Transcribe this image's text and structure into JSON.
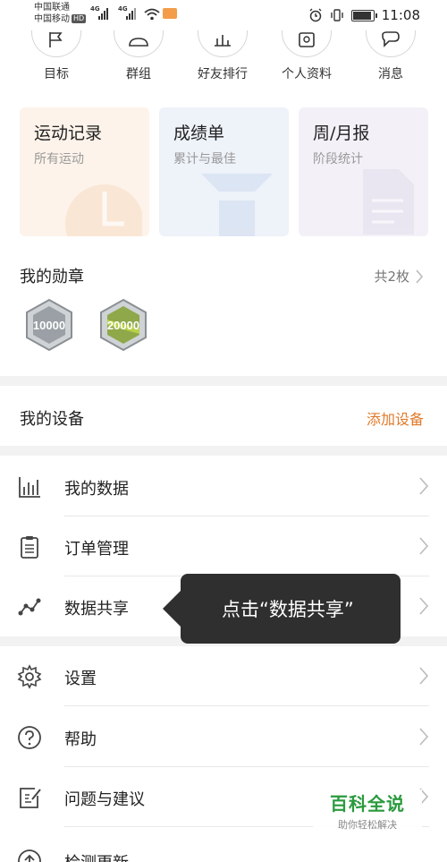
{
  "status_bar": {
    "carrier1": "中国联通",
    "carrier2": "中国移动",
    "hd": "HD",
    "net1": "4G",
    "net2": "4G",
    "time": "11:08"
  },
  "top_nav": [
    {
      "label": "目标",
      "icon": "flag-icon"
    },
    {
      "label": "群组",
      "icon": "group-icon"
    },
    {
      "label": "好友排行",
      "icon": "ranking-icon"
    },
    {
      "label": "个人资料",
      "icon": "profile-icon"
    },
    {
      "label": "消息",
      "icon": "message-icon"
    }
  ],
  "cards": [
    {
      "title": "运动记录",
      "subtitle": "所有运动",
      "bg": "#fdf3ea"
    },
    {
      "title": "成绩单",
      "subtitle": "累计与最佳",
      "bg": "#eef2f9"
    },
    {
      "title": "周/月报",
      "subtitle": "阶段统计",
      "bg": "#f3f0f7"
    }
  ],
  "medals": {
    "title": "我的勋章",
    "count": "共2枚",
    "items": [
      {
        "label": "10000"
      },
      {
        "label": "20000"
      }
    ]
  },
  "devices": {
    "title": "我的设备",
    "add_label": "添加设备",
    "accent": "#e07a2a"
  },
  "menu": [
    {
      "label": "我的数据",
      "icon": "bar-chart-icon"
    },
    {
      "label": "订单管理",
      "icon": "clipboard-icon"
    },
    {
      "label": "数据共享",
      "icon": "share-nodes-icon"
    },
    {
      "label": "设置",
      "icon": "gear-icon"
    },
    {
      "label": "帮助",
      "icon": "help-icon"
    },
    {
      "label": "问题与建议",
      "icon": "feedback-icon"
    },
    {
      "label": "检测更新",
      "icon": "update-icon"
    }
  ],
  "tooltip": {
    "text": "点击“数据共享”"
  },
  "watermark": {
    "title": "百科全说",
    "subtitle": "助你轻松解决"
  }
}
